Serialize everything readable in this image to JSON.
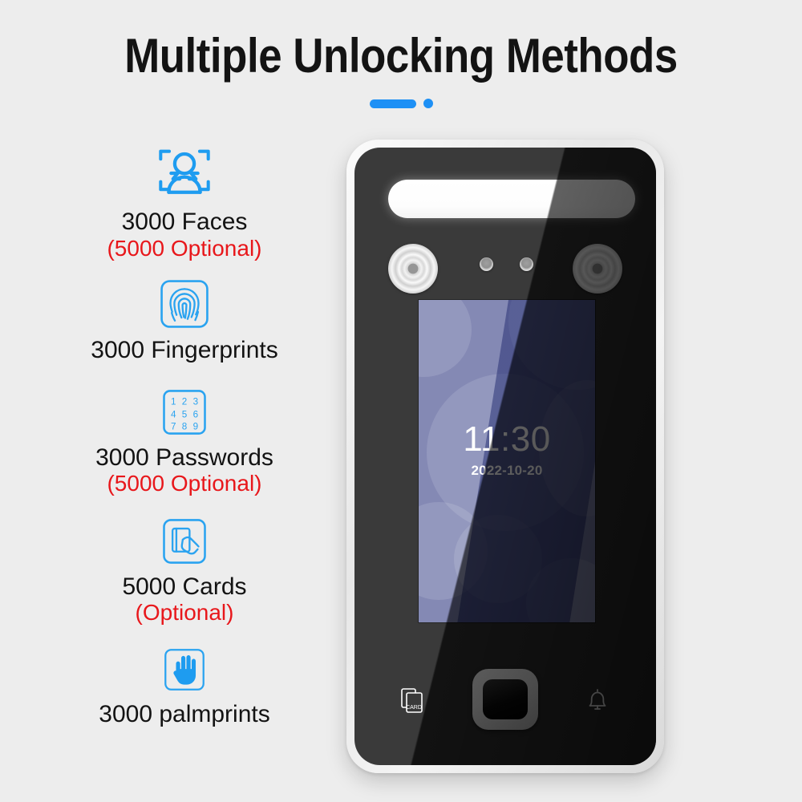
{
  "page": {
    "background_color": "#ededed",
    "accent_color": "#1e90f5",
    "optional_color": "#e8171b"
  },
  "header": {
    "title": "Multiple Unlocking Methods",
    "accent_bar": "blue-pill",
    "accent_dot": "blue-dot"
  },
  "features": [
    {
      "icon": "face-recognition-icon",
      "main": "3000 Faces",
      "optional": "(5000 Optional)"
    },
    {
      "icon": "fingerprint-icon",
      "main": "3000 Fingerprints",
      "optional": ""
    },
    {
      "icon": "keypad-icon",
      "main": "3000 Passwords",
      "optional": "(5000 Optional)",
      "keys": [
        "1",
        "2",
        "3",
        "4",
        "5",
        "6",
        "7",
        "8",
        "9"
      ]
    },
    {
      "icon": "card-swipe-icon",
      "main": "5000 Cards",
      "optional": "(Optional)"
    },
    {
      "icon": "palm-icon",
      "main": "3000 palmprints",
      "optional": ""
    }
  ],
  "device": {
    "name": "face-recognition-terminal",
    "light_bar": "white-led-fill-light",
    "cameras": [
      "ir-illuminator-left",
      "ir-illuminator-right"
    ],
    "sensors": [
      "proximity-sensor-1",
      "proximity-sensor-2"
    ],
    "screen": {
      "time": "11:30",
      "date": "2022-10-20",
      "wallpaper_color": "#7d82b0",
      "wallpaper_shade_color": "#1e266e",
      "text_color": "#ffffff"
    },
    "controls": [
      {
        "name": "card-reader-icon",
        "label": "CARD"
      },
      {
        "name": "home-fingerprint-button",
        "label": ""
      },
      {
        "name": "doorbell-icon",
        "label": ""
      }
    ]
  }
}
